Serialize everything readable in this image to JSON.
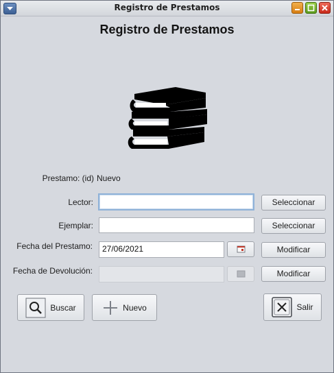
{
  "window": {
    "title": "Registro de Prestamos"
  },
  "heading": "Registro de Prestamos",
  "icons": {
    "menu": "menu-down-icon",
    "minimize": "minimize-icon",
    "maximize": "maximize-icon",
    "close": "close-icon",
    "books": "books-stack-icon",
    "calendar": "calendar-icon",
    "search": "search-icon",
    "plus": "plus-icon",
    "exit": "exit-icon"
  },
  "form": {
    "prestamo_label": "Prestamo: (id)",
    "prestamo_value": "Nuevo",
    "lector_label": "Lector:",
    "lector_value": "",
    "ejemplar_label": "Ejemplar:",
    "ejemplar_value": "",
    "fecha_prestamo_label": "Fecha del Prestamo:",
    "fecha_prestamo_value": "27/06/2021",
    "fecha_devolucion_label": "Fecha de Devolución:",
    "fecha_devolucion_value": ""
  },
  "buttons": {
    "seleccionar_lector": "Seleccionar",
    "seleccionar_ejemplar": "Seleccionar",
    "modificar_prestamo": "Modificar",
    "modificar_devolucion": "Modificar",
    "buscar": "Buscar",
    "nuevo": "Nuevo",
    "salir": "Salir"
  }
}
